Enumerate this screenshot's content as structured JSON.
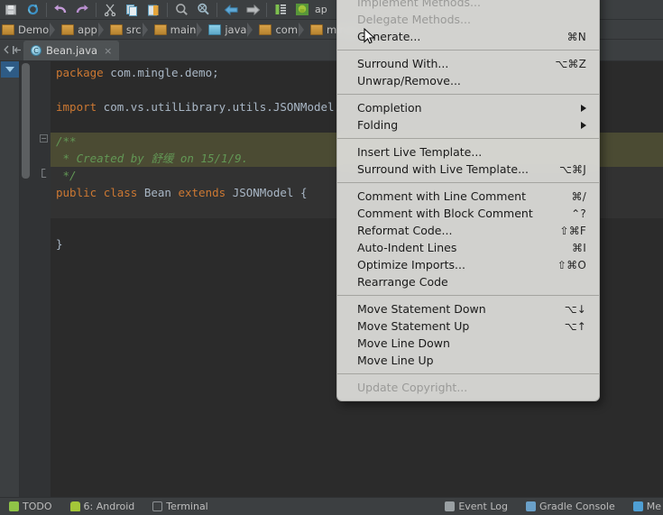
{
  "toolbar": {
    "icons": [
      {
        "name": "save-all-icon",
        "glyph": "ὋE"
      },
      {
        "name": "sync-refresh-icon",
        "glyph": "↻"
      },
      {
        "name": "undo-icon",
        "glyph": "↶"
      },
      {
        "name": "redo-icon",
        "glyph": "↷"
      },
      {
        "name": "cut-icon",
        "glyph": "✂"
      },
      {
        "name": "copy-icon",
        "glyph": "⧉"
      },
      {
        "name": "paste-icon",
        "glyph": "ὌB"
      },
      {
        "name": "find-icon",
        "glyph": "ὐD"
      },
      {
        "name": "replace-icon",
        "glyph": "ὐE"
      },
      {
        "name": "back-icon",
        "glyph": "←"
      },
      {
        "name": "forward-icon",
        "glyph": "→"
      },
      {
        "name": "compile-icon",
        "glyph": "⚙"
      },
      {
        "name": "android-sdk-icon",
        "glyph": "ᾑ6"
      }
    ],
    "android_label": "ap"
  },
  "breadcrumb": {
    "items": [
      {
        "label": "Demo",
        "kind": "module"
      },
      {
        "label": "app",
        "kind": "module"
      },
      {
        "label": "src",
        "kind": "folder"
      },
      {
        "label": "main",
        "kind": "folder"
      },
      {
        "label": "java",
        "kind": "source-folder"
      },
      {
        "label": "com",
        "kind": "package"
      },
      {
        "label": "mingle",
        "kind": "package"
      }
    ]
  },
  "tabs": {
    "active": {
      "label": "Bean.java",
      "icon": "class-icon",
      "icon_glyph": "C",
      "close": "×"
    }
  },
  "editor": {
    "lines": [
      {
        "highlight": "none",
        "segments": [
          {
            "text": "package",
            "style": "kw"
          },
          {
            "text": " com.mingle.demo;",
            "style": "txt"
          }
        ]
      },
      {
        "highlight": "none",
        "segments": []
      },
      {
        "highlight": "none",
        "segments": [
          {
            "text": "import",
            "style": "kw"
          },
          {
            "text": " com.vs.utilLibrary.utils.JSONModel;",
            "style": "txt"
          }
        ]
      },
      {
        "highlight": "none",
        "segments": []
      },
      {
        "highlight": "comment",
        "segments": [
          {
            "text": "/**",
            "style": "cmt"
          }
        ]
      },
      {
        "highlight": "comment",
        "segments": [
          {
            "text": " * Created by 舒缓 on 15/1/9.",
            "style": "cmt"
          }
        ]
      },
      {
        "highlight": "line",
        "segments": [
          {
            "text": " */",
            "style": "cmt"
          }
        ]
      },
      {
        "highlight": "line",
        "segments": [
          {
            "text": "public",
            "style": "kw"
          },
          {
            "text": " ",
            "style": "txt"
          },
          {
            "text": "class",
            "style": "kw"
          },
          {
            "text": " Bean ",
            "style": "txt"
          },
          {
            "text": "extends",
            "style": "kw"
          },
          {
            "text": " JSONModel {",
            "style": "txt"
          }
        ]
      },
      {
        "highlight": "line",
        "segments": []
      },
      {
        "highlight": "none",
        "segments": []
      },
      {
        "highlight": "none",
        "segments": [
          {
            "text": "}",
            "style": "txt"
          }
        ]
      }
    ]
  },
  "context_menu": {
    "groups": [
      {
        "items": [
          {
            "label": "Implement Methods...",
            "shortcut": "",
            "disabled": true,
            "submenu": false
          },
          {
            "label": "Delegate Methods...",
            "shortcut": "",
            "disabled": true,
            "submenu": false
          },
          {
            "label": "Generate...",
            "shortcut": "⌘N",
            "disabled": false,
            "submenu": false,
            "hovered": true
          }
        ]
      },
      {
        "items": [
          {
            "label": "Surround With...",
            "shortcut": "⌥⌘Z",
            "disabled": false,
            "submenu": false
          },
          {
            "label": "Unwrap/Remove...",
            "shortcut": "",
            "disabled": false,
            "submenu": false
          }
        ]
      },
      {
        "items": [
          {
            "label": "Completion",
            "shortcut": "",
            "disabled": false,
            "submenu": true
          },
          {
            "label": "Folding",
            "shortcut": "",
            "disabled": false,
            "submenu": true
          }
        ]
      },
      {
        "items": [
          {
            "label": "Insert Live Template...",
            "shortcut": "",
            "disabled": false,
            "submenu": false
          },
          {
            "label": "Surround with Live Template...",
            "shortcut": "⌥⌘J",
            "disabled": false,
            "submenu": false
          }
        ]
      },
      {
        "items": [
          {
            "label": "Comment with Line Comment",
            "shortcut": "⌘/",
            "disabled": false,
            "submenu": false
          },
          {
            "label": "Comment with Block Comment",
            "shortcut": "⌃?",
            "disabled": false,
            "submenu": false
          },
          {
            "label": "Reformat Code...",
            "shortcut": "⇧⌘F",
            "disabled": false,
            "submenu": false
          },
          {
            "label": "Auto-Indent Lines",
            "shortcut": "⌘I",
            "disabled": false,
            "submenu": false
          },
          {
            "label": "Optimize Imports...",
            "shortcut": "⇧⌘O",
            "disabled": false,
            "submenu": false
          },
          {
            "label": "Rearrange Code",
            "shortcut": "",
            "disabled": false,
            "submenu": false
          }
        ]
      },
      {
        "items": [
          {
            "label": "Move Statement Down",
            "shortcut": "⌥↓",
            "disabled": false,
            "submenu": false
          },
          {
            "label": "Move Statement Up",
            "shortcut": "⌥↑",
            "disabled": false,
            "submenu": false
          },
          {
            "label": "Move Line Down",
            "shortcut": "",
            "disabled": false,
            "submenu": false
          },
          {
            "label": "Move Line Up",
            "shortcut": "",
            "disabled": false,
            "submenu": false
          }
        ]
      },
      {
        "items": [
          {
            "label": "Update Copyright...",
            "shortcut": "",
            "disabled": true,
            "submenu": false
          }
        ]
      }
    ]
  },
  "statusbar": {
    "left": [
      {
        "label": "TODO",
        "icon": "todo-icon",
        "color": "#8fc447"
      },
      {
        "label": "6: Android",
        "icon": "android-icon",
        "color": "#a4c639"
      },
      {
        "label": "Terminal",
        "icon": "terminal-icon",
        "color": "#8d9194"
      }
    ],
    "right": [
      {
        "label": "Event Log",
        "icon": "event-log-icon",
        "color": "#9aa0a3"
      },
      {
        "label": "Gradle Console",
        "icon": "gradle-console-icon",
        "color": "#6aa0c8"
      },
      {
        "label": "Me",
        "icon": "memory-icon",
        "color": "#4f9fd4"
      }
    ]
  },
  "colors": {
    "editor_bg": "#2b2b2b",
    "chrome_bg": "#3c3f41",
    "menu_bg": "#ded bee",
    "comment_highlight": "#4b4b33",
    "accent_blue": "#2e5b85"
  }
}
